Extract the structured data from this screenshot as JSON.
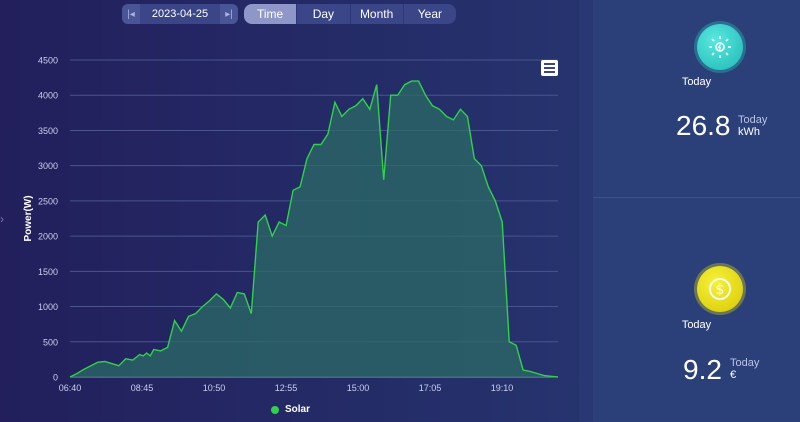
{
  "date_nav": {
    "date": "2023-04-25",
    "prev_icon": "skip-back-icon",
    "next_icon": "skip-forward-icon"
  },
  "tabs": [
    {
      "label": "Time",
      "active": true
    },
    {
      "label": "Day",
      "active": false
    },
    {
      "label": "Month",
      "active": false
    },
    {
      "label": "Year",
      "active": false
    }
  ],
  "chart_data": {
    "type": "area",
    "ylabel": "Power(W)",
    "ylim": [
      0,
      4500
    ],
    "y_ticks": [
      0,
      500,
      1000,
      1500,
      2000,
      2500,
      3000,
      3500,
      4000,
      4500
    ],
    "x_tick_labels": [
      "06:40",
      "08:45",
      "10:50",
      "12:55",
      "15:00",
      "17:05",
      "19:10"
    ],
    "x_range_minutes": [
      400,
      1100
    ],
    "grid": true,
    "legend_position": "bottom",
    "series": [
      {
        "name": "Solar",
        "color": "#2fd24a",
        "x_minutes": [
          400,
          410,
          420,
          430,
          440,
          450,
          460,
          470,
          480,
          490,
          500,
          505,
          510,
          515,
          520,
          525,
          530,
          540,
          550,
          560,
          570,
          580,
          590,
          600,
          610,
          620,
          630,
          640,
          650,
          660,
          670,
          680,
          690,
          700,
          710,
          720,
          730,
          740,
          750,
          760,
          770,
          780,
          790,
          800,
          810,
          820,
          830,
          840,
          850,
          860,
          870,
          880,
          890,
          900,
          910,
          920,
          930,
          940,
          950,
          960,
          970,
          980,
          990,
          1000,
          1010,
          1020,
          1030,
          1040,
          1050,
          1060,
          1070,
          1080,
          1090,
          1100
        ],
        "y": [
          0,
          50,
          110,
          160,
          210,
          220,
          190,
          160,
          260,
          240,
          320,
          300,
          340,
          300,
          390,
          380,
          370,
          420,
          800,
          650,
          860,
          900,
          1000,
          1080,
          1180,
          1100,
          980,
          1200,
          1180,
          900,
          2200,
          2300,
          2000,
          2200,
          2150,
          2650,
          2700,
          3100,
          3300,
          3300,
          3450,
          3900,
          3700,
          3800,
          3850,
          3950,
          3800,
          4150,
          2800,
          4000,
          4000,
          4150,
          4200,
          4200,
          4000,
          3850,
          3800,
          3700,
          3650,
          3800,
          3700,
          3100,
          3000,
          2700,
          2500,
          2200,
          500,
          450,
          100,
          80,
          50,
          20,
          10,
          0
        ]
      }
    ]
  },
  "right_panel": {
    "energy": {
      "icon": "sun-icon",
      "label": "Today",
      "value": "26.8",
      "sub_label": "Today",
      "unit": "kWh"
    },
    "revenue": {
      "icon": "dollar-icon",
      "label": "Today",
      "value": "9.2",
      "sub_label": "Today",
      "unit": "€"
    }
  }
}
